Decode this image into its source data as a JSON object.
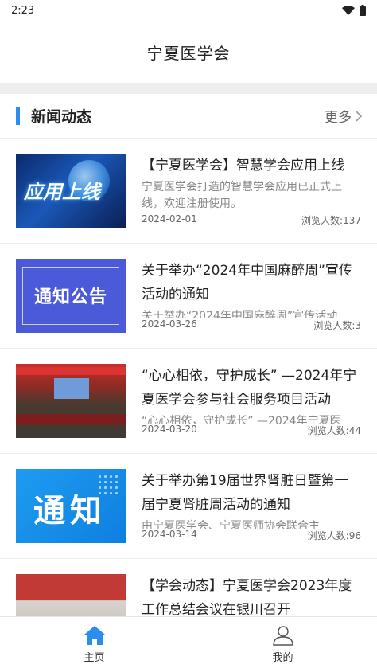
{
  "status_bar": {
    "time": "2:23"
  },
  "header": {
    "title": "宁夏医学会"
  },
  "section": {
    "title": "新闻动态",
    "more_label": "更多"
  },
  "news": [
    {
      "title": "【宁夏医学会】智慧学会应用上线",
      "summary": "宁夏医学会打造的智慧学会应用已正式上线，欢迎注册使用。",
      "date": "2024-02-01",
      "views": "浏览人数:137",
      "thumb_text": "应用上线"
    },
    {
      "title": "关于举办“2024年中国麻醉周”宣传活动的通知",
      "summary": "关于举办“2024年中国麻醉周”宣传活动",
      "date": "2024-03-26",
      "views": "浏览人数:3",
      "thumb_text": "通知公告"
    },
    {
      "title": "“心心相依，守护成长” —2024年宁夏医学会参与社会服务项目活动",
      "summary": "“心心相依，守护成长” —2024年宁夏医",
      "date": "2024-03-20",
      "views": "浏览人数:44",
      "thumb_text": ""
    },
    {
      "title": "关于举办第19届世界肾脏日暨第一届宁夏肾脏周活动的通知",
      "summary": "由宁夏医学会、宁夏医师协会联合主",
      "date": "2024-03-14",
      "views": "浏览人数:96",
      "thumb_text": "通知"
    },
    {
      "title": "【学会动态】宁夏医学会2023年度工作总结会议在银川召开",
      "summary": "",
      "date": "",
      "views": "",
      "thumb_text": ""
    }
  ],
  "tabbar": {
    "home": "主页",
    "mine": "我的"
  },
  "colors": {
    "accent": "#2c8cf0",
    "home_icon": "#2c8cf0"
  }
}
